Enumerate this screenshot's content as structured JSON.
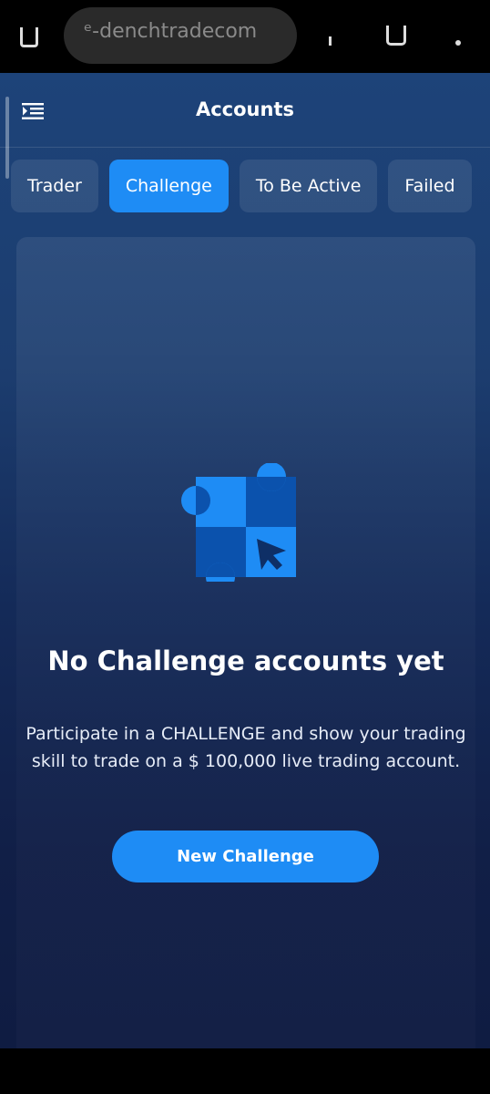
{
  "browser": {
    "url": "ᵉ-denchtradecom"
  },
  "header": {
    "title": "Accounts",
    "menu_icon": "menu-collapse-icon"
  },
  "tabs": [
    {
      "label": "Trader",
      "active": false
    },
    {
      "label": "Challenge",
      "active": true
    },
    {
      "label": "To Be Active",
      "active": false
    },
    {
      "label": "Failed",
      "active": false
    }
  ],
  "empty_state": {
    "icon": "challenge-grid-cursor-icon",
    "title": "No Challenge accounts yet",
    "description": "Participate in a CHALLENGE and show your trading skill to trade on a $ 100,000 live trading account.",
    "button_label": "New Challenge"
  },
  "colors": {
    "accent": "#1e8cf5",
    "background_top": "#1d4379",
    "background_bottom": "#0f1c42"
  }
}
